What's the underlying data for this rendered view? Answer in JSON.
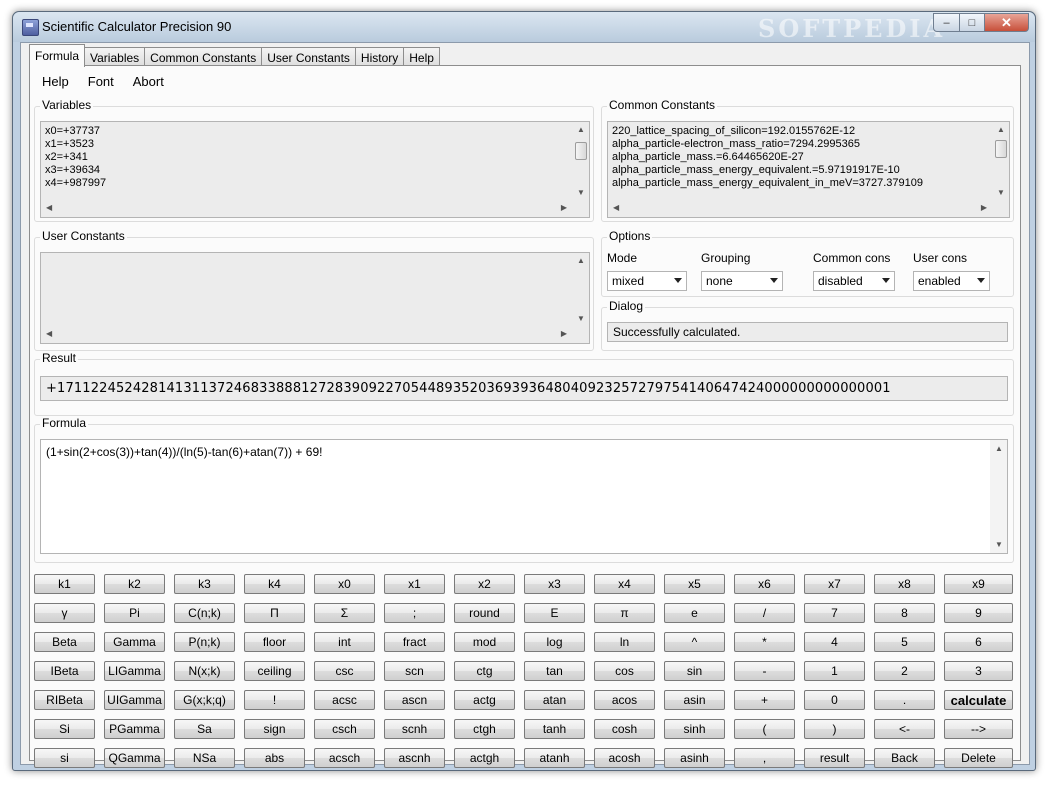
{
  "window": {
    "title": "Scientific Calculator Precision 90",
    "watermark": "SOFTPEDIA"
  },
  "tabs": [
    "Formula",
    "Variables",
    "Common Constants",
    "User Constants",
    "History",
    "Help"
  ],
  "menu": [
    "Help",
    "Font",
    "Abort"
  ],
  "variables": {
    "label": "Variables",
    "items": [
      "x0=+37737",
      "x1=+3523",
      "x2=+341",
      "x3=+39634",
      "x4=+987997"
    ]
  },
  "common_constants": {
    "label": "Common Constants",
    "items": [
      "220_lattice_spacing_of_silicon=192.0155762E-12",
      "alpha_particle-electron_mass_ratio=7294.2995365",
      "alpha_particle_mass.=6.64465620E-27",
      "alpha_particle_mass_energy_equivalent.=5.97191917E-10",
      "alpha_particle_mass_energy_equivalent_in_meV=3727.379109"
    ]
  },
  "user_constants": {
    "label": "User Constants",
    "items": []
  },
  "options": {
    "label": "Options",
    "fields": [
      {
        "label": "Mode",
        "value": "mixed"
      },
      {
        "label": "Grouping",
        "value": "none"
      },
      {
        "label": "Common cons",
        "value": "disabled"
      },
      {
        "label": "User cons",
        "value": "enabled"
      }
    ]
  },
  "dialog": {
    "label": "Dialog",
    "message": "Successfully calculated."
  },
  "result": {
    "label": "Result",
    "value": "+171122452428141311372468338881272839092270544893520369393648040923257279754140647424000000000000001"
  },
  "formula": {
    "label": "Formula",
    "value": "(1+sin(2+cos(3))+tan(4))/(ln(5)-tan(6)+atan(7)) + 69!"
  },
  "keypad": [
    [
      "k1",
      "k2",
      "k3",
      "k4",
      "x0",
      "x1",
      "x2",
      "x3",
      "x4",
      "x5",
      "x6",
      "x7",
      "x8",
      "x9"
    ],
    [
      "γ",
      "Pi",
      "C(n;k)",
      "Π",
      "Σ",
      ";",
      "round",
      "E",
      "π",
      "e",
      "/",
      "7",
      "8",
      "9"
    ],
    [
      "Beta",
      "Gamma",
      "P(n;k)",
      "floor",
      "int",
      "fract",
      "mod",
      "log",
      "ln",
      "^",
      "*",
      "4",
      "5",
      "6"
    ],
    [
      "IBeta",
      "LIGamma",
      "N(x;k)",
      "ceiling",
      "csc",
      "scn",
      "ctg",
      "tan",
      "cos",
      "sin",
      "-",
      "1",
      "2",
      "3"
    ],
    [
      "RIBeta",
      "UIGamma",
      "G(x;k;q)",
      "!",
      "acsc",
      "ascn",
      "actg",
      "atan",
      "acos",
      "asin",
      "+",
      "0",
      ".",
      "calculate"
    ],
    [
      "Si",
      "PGamma",
      "Sa",
      "sign",
      "csch",
      "scnh",
      "ctgh",
      "tanh",
      "cosh",
      "sinh",
      "(",
      ")",
      "<-",
      "-->"
    ],
    [
      "si",
      "QGamma",
      "NSa",
      "abs",
      "acsch",
      "ascnh",
      "actgh",
      "atanh",
      "acosh",
      "asinh",
      ",",
      "result",
      "Back",
      "Delete"
    ]
  ]
}
